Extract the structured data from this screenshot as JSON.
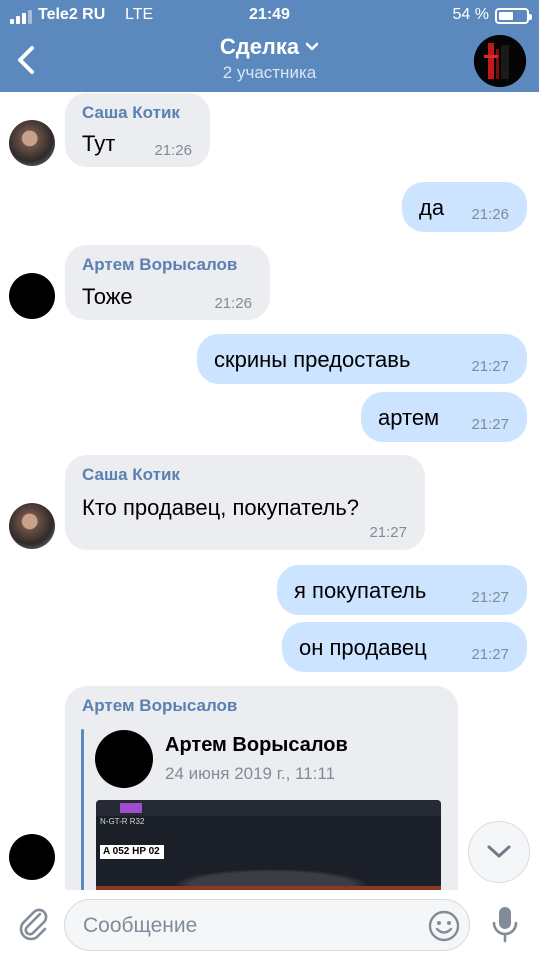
{
  "status_bar": {
    "carrier": "Tele2 RU",
    "network": "LTE",
    "time": "21:49",
    "battery_percent": "54 %",
    "battery_level": 0.54
  },
  "header": {
    "title": "Сделка",
    "subtitle": "2 участника",
    "accent_color": "#5b88bd"
  },
  "messages": [
    {
      "direction": "in",
      "sender": "Саша Котик",
      "text": "Тут",
      "time": "21:26"
    },
    {
      "direction": "out",
      "text": "да",
      "time": "21:26"
    },
    {
      "direction": "in",
      "sender": "Артем Ворысалов",
      "text": "Тоже",
      "time": "21:26"
    },
    {
      "direction": "out",
      "text": "скрины предоставь",
      "time": "21:27"
    },
    {
      "direction": "out",
      "text": "артем",
      "time": "21:27"
    },
    {
      "direction": "in",
      "sender": "Саша Котик",
      "text": "Кто продавец, покупатель?",
      "time": "21:27"
    },
    {
      "direction": "out",
      "text": "я покупатель",
      "time": "21:27"
    },
    {
      "direction": "out",
      "text": "он продавец",
      "time": "21:27"
    }
  ],
  "forwarded": {
    "sender": "Артем Ворысалов",
    "post_author": "Артем Ворысалов",
    "post_date": "24 июня 2019 г., 11:11",
    "image": {
      "model_label": "N-GT-R R32",
      "plate": "A 052 HP 02"
    }
  },
  "composer": {
    "placeholder": "Сообщение"
  },
  "icons": [
    "back-arrow-icon",
    "chevron-down-icon",
    "paperclip-icon",
    "emoji-icon",
    "microphone-icon",
    "scroll-down-icon"
  ]
}
